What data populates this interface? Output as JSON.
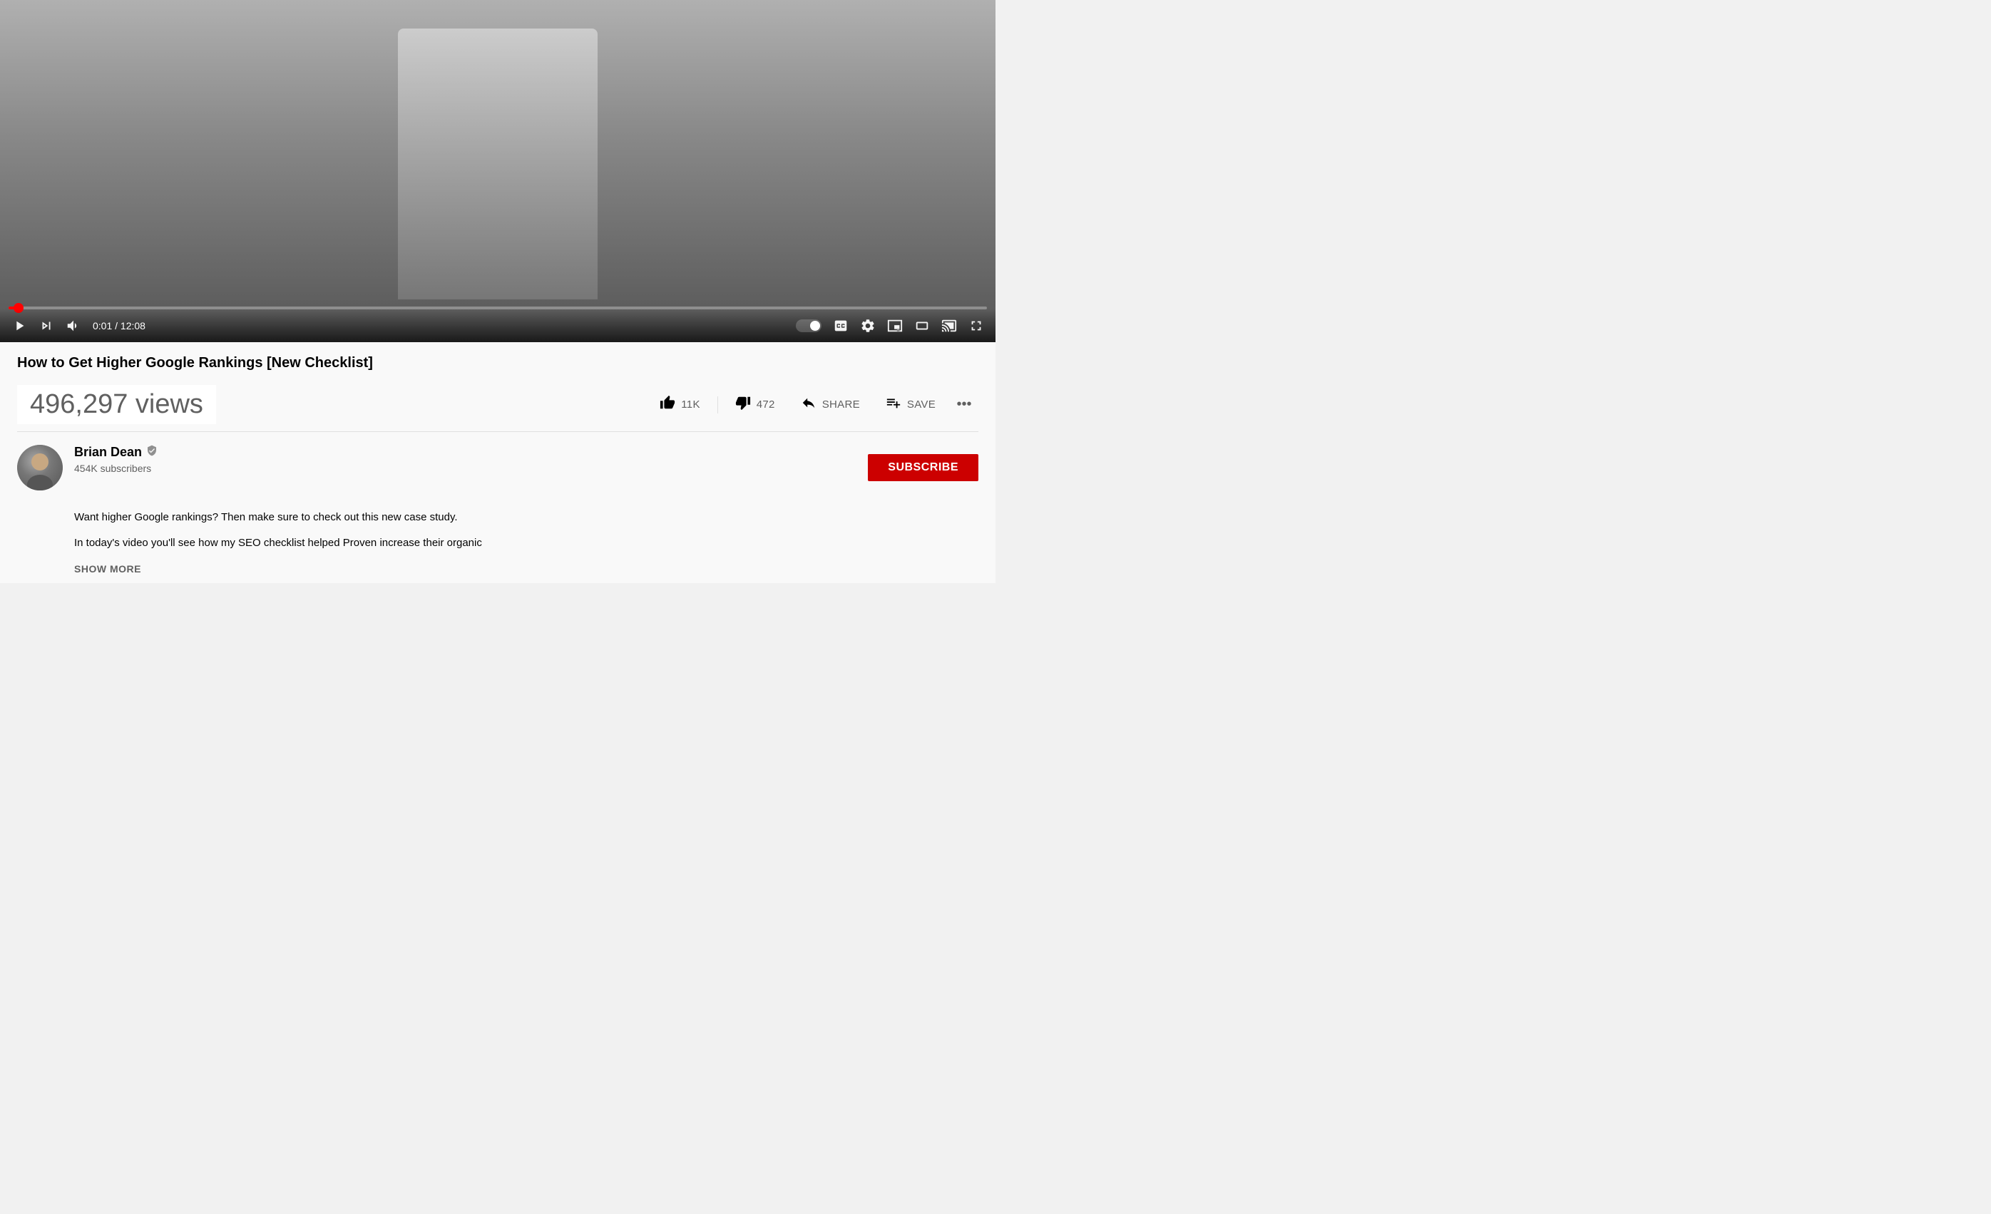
{
  "video": {
    "player": {
      "progress_percent": 1,
      "current_time": "0:01",
      "total_time": "12:08",
      "time_display": "0:01 / 12:08"
    },
    "title": "How to Get Higher Google Rankings [New Checklist]",
    "views": "496,297 views",
    "actions": {
      "like_label": "11K",
      "dislike_label": "472",
      "share_label": "SHARE",
      "save_label": "SAVE"
    }
  },
  "channel": {
    "name": "Brian Dean",
    "verified": true,
    "subscribers": "454K subscribers",
    "subscribe_label": "SUBSCRIBE",
    "description_1": "Want higher Google rankings? Then make sure to check out this new case study.",
    "description_2": "In today's video you'll see how my SEO checklist helped Proven increase their organic",
    "show_more": "SHOW MORE"
  },
  "icons": {
    "play": "▶",
    "next": "⏭",
    "volume": "🔊",
    "cc": "CC",
    "settings": "⚙",
    "miniplayer": "⊡",
    "theater": "▭",
    "cast": "⊞",
    "fullscreen": "⛶",
    "autoplay": "autoplay",
    "checkmark": "✓",
    "dots": "•••"
  }
}
